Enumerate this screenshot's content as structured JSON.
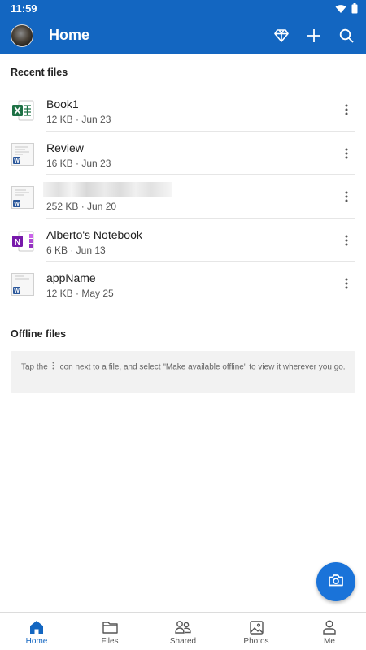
{
  "status_bar": {
    "time": "11:59"
  },
  "app_bar": {
    "title": "Home",
    "icons": [
      "premium-diamond-icon",
      "add-icon",
      "search-icon"
    ]
  },
  "recent": {
    "title": "Recent files",
    "files": [
      {
        "name": "Book1",
        "meta": "12 KB · Jun 23",
        "type": "excel"
      },
      {
        "name": "Review",
        "meta": "16 KB · Jun 23",
        "type": "word"
      },
      {
        "name": "",
        "meta": "252 KB · Jun 20",
        "type": "word"
      },
      {
        "name": "Alberto's Notebook",
        "meta": "6 KB · Jun 13",
        "type": "onenote"
      },
      {
        "name": "appName",
        "meta": "12 KB · May 25",
        "type": "word"
      }
    ]
  },
  "offline": {
    "title": "Offline files",
    "hint_before": "Tap the ",
    "hint_after": " icon next to a file, and select \"Make available offline\" to view it wherever you go."
  },
  "bottom_nav": {
    "items": [
      {
        "label": "Home",
        "icon": "home-icon",
        "active": true
      },
      {
        "label": "Files",
        "icon": "folder-icon",
        "active": false
      },
      {
        "label": "Shared",
        "icon": "shared-people-icon",
        "active": false
      },
      {
        "label": "Photos",
        "icon": "photo-icon",
        "active": false
      },
      {
        "label": "Me",
        "icon": "person-icon",
        "active": false
      }
    ]
  },
  "colors": {
    "brand_blue": "#1366c1",
    "excel_green": "#1e7145",
    "word_blue": "#2b579a",
    "onenote_purple": "#7719aa"
  }
}
